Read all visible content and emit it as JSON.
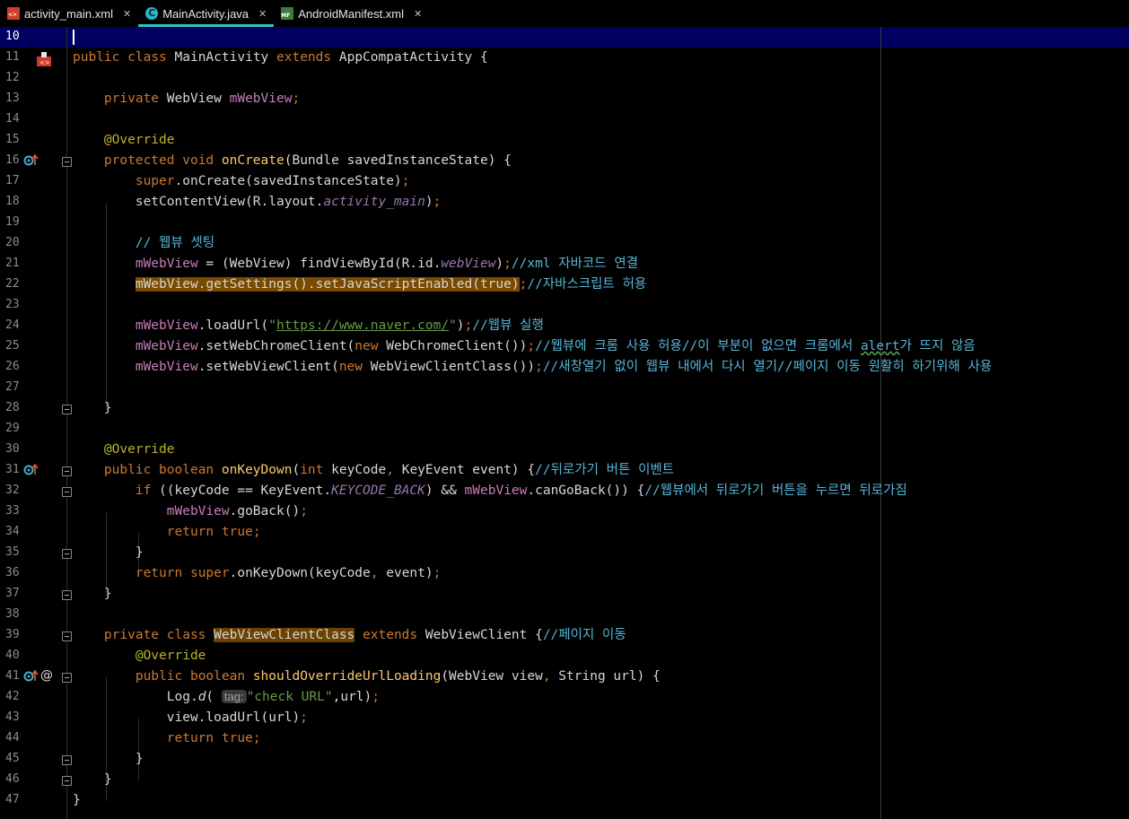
{
  "tabs": [
    {
      "label": "activity_main.xml",
      "icon": "xml-file-icon",
      "active": false
    },
    {
      "label": "MainActivity.java",
      "icon": "java-class-icon",
      "active": true
    },
    {
      "label": "AndroidManifest.xml",
      "icon": "manifest-file-icon",
      "active": false
    }
  ],
  "editor": {
    "current_line": "10",
    "lines": [
      {
        "n": "10"
      },
      {
        "n": "11"
      },
      {
        "n": "12"
      },
      {
        "n": "13"
      },
      {
        "n": "14"
      },
      {
        "n": "15"
      },
      {
        "n": "16"
      },
      {
        "n": "17"
      },
      {
        "n": "18"
      },
      {
        "n": "19"
      },
      {
        "n": "20"
      },
      {
        "n": "21"
      },
      {
        "n": "22"
      },
      {
        "n": "23"
      },
      {
        "n": "24"
      },
      {
        "n": "25"
      },
      {
        "n": "26"
      },
      {
        "n": "27"
      },
      {
        "n": "28"
      },
      {
        "n": "29"
      },
      {
        "n": "30"
      },
      {
        "n": "31"
      },
      {
        "n": "32"
      },
      {
        "n": "33"
      },
      {
        "n": "34"
      },
      {
        "n": "35"
      },
      {
        "n": "36"
      },
      {
        "n": "37"
      },
      {
        "n": "38"
      },
      {
        "n": "39"
      },
      {
        "n": "40"
      },
      {
        "n": "41"
      },
      {
        "n": "42"
      },
      {
        "n": "43"
      },
      {
        "n": "44"
      },
      {
        "n": "45"
      },
      {
        "n": "46"
      },
      {
        "n": "47"
      }
    ],
    "code": {
      "l11_kw1": "public",
      "l11_kw2": "class",
      "l11_cls": "MainActivity",
      "l11_kw3": "extends",
      "l11_base": "AppCompatActivity {",
      "l13_kw": "private",
      "l13_type": "WebView",
      "l13_fld": "mWebView",
      "l15_an": "@Override",
      "l16_kw1": "protected",
      "l16_kw2": "void",
      "l16_mt": "onCreate",
      "l16_rest": "(Bundle savedInstanceState) {",
      "l17_kw": "super",
      "l17_rest": ".onCreate(savedInstanceState)",
      "l18_a": "setContentView(R.layout.",
      "l18_it": "activity_main",
      "l18_b": ")",
      "l20_cm": "// 웹뷰 셋팅",
      "l21_fld": "mWebView",
      "l21_a": " = (WebView) findViewById(R.id.",
      "l21_it": "webView",
      "l21_b": ")",
      "l21_cm": "//xml 자바코드 연결",
      "l22_hl": "mWebView.getSettings().setJavaScriptEnabled(true)",
      "l22_cm": "//자바스크립트 허용",
      "l24_fld": "mWebView",
      "l24_a": ".loadUrl(",
      "l24_q1": "\"",
      "l24_url": "https://www.naver.com/",
      "l24_q2": "\"",
      "l24_b": ")",
      "l24_cm": "//웹뷰 실행",
      "l25_fld": "mWebView",
      "l25_a": ".setWebChromeClient(",
      "l25_kw": "new",
      "l25_b": " WebChromeClient())",
      "l25_cm1": "//웹뷰에 크롬 사용 허용//이 부분이 없으면 크롬에서 ",
      "l25_cm2": "alert",
      "l25_cm3": "가 뜨지 않음",
      "l26_fld": "mWebView",
      "l26_a": ".setWebViewClient(",
      "l26_kw": "new",
      "l26_b": " WebViewClientClass())",
      "l26_cm": "//새창열기 없이 웹뷰 내에서 다시 열기//페이지 이동 원활히 하기위해 사용",
      "l28": "}",
      "l30_an": "@Override",
      "l31_kw1": "public",
      "l31_kw2": "boolean",
      "l31_mt": "onKeyDown",
      "l31_a": "(",
      "l31_kw3": "int",
      "l31_b": " keyCode",
      "l31_c": " KeyEvent event) {",
      "l31_cm": "//뒤로가기 버튼 이벤트",
      "l32_kw": "if",
      "l32_a": " ((keyCode == KeyEvent.",
      "l32_cst": "KEYCODE_BACK",
      "l32_b": ") && ",
      "l32_fld": "mWebView",
      "l32_c": ".canGoBack()) {",
      "l32_cm": "//웹뷰에서 뒤로가기 버튼을 누르면 뒤로가짐",
      "l33_fld": "mWebView",
      "l33_a": ".goBack()",
      "l34_kw1": "return",
      "l34_kw2": "true",
      "l35": "}",
      "l36_kw1": "return",
      "l36_kw2": "super",
      "l36_a": ".onKeyDown(keyCode",
      "l36_b": " event)",
      "l37": "}",
      "l39_kw1": "private",
      "l39_kw2": "class",
      "l39_hl": "WebViewClientClass",
      "l39_kw3": "extends",
      "l39_a": " WebViewClient {",
      "l39_cm": "//페이지 이동",
      "l40_an": "@Override",
      "l41_kw1": "public",
      "l41_kw2": "boolean",
      "l41_mt": "shouldOverrideUrlLoading",
      "l41_a": "(WebView view",
      "l41_b": " String url) {",
      "l42_a": "Log.",
      "l42_it": "d",
      "l42_b": "(",
      "l42_hint": "tag:",
      "l42_str": "\"check URL\"",
      "l42_c": ",url)",
      "l43_a": "view.loadUrl(url)",
      "l44_kw1": "return",
      "l44_kw2": "true",
      "l45": "}",
      "l46": "}",
      "l47": "}"
    }
  },
  "colors": {
    "background": "#000000",
    "current_line": "#000060",
    "keyword": "#cc7832",
    "field": "#c77dbb",
    "method": "#ffc66d",
    "annotation": "#bbb529",
    "comment": "#56b6d6",
    "string": "#6a9a4a",
    "active_tab_underline": "#2dc3c3"
  }
}
